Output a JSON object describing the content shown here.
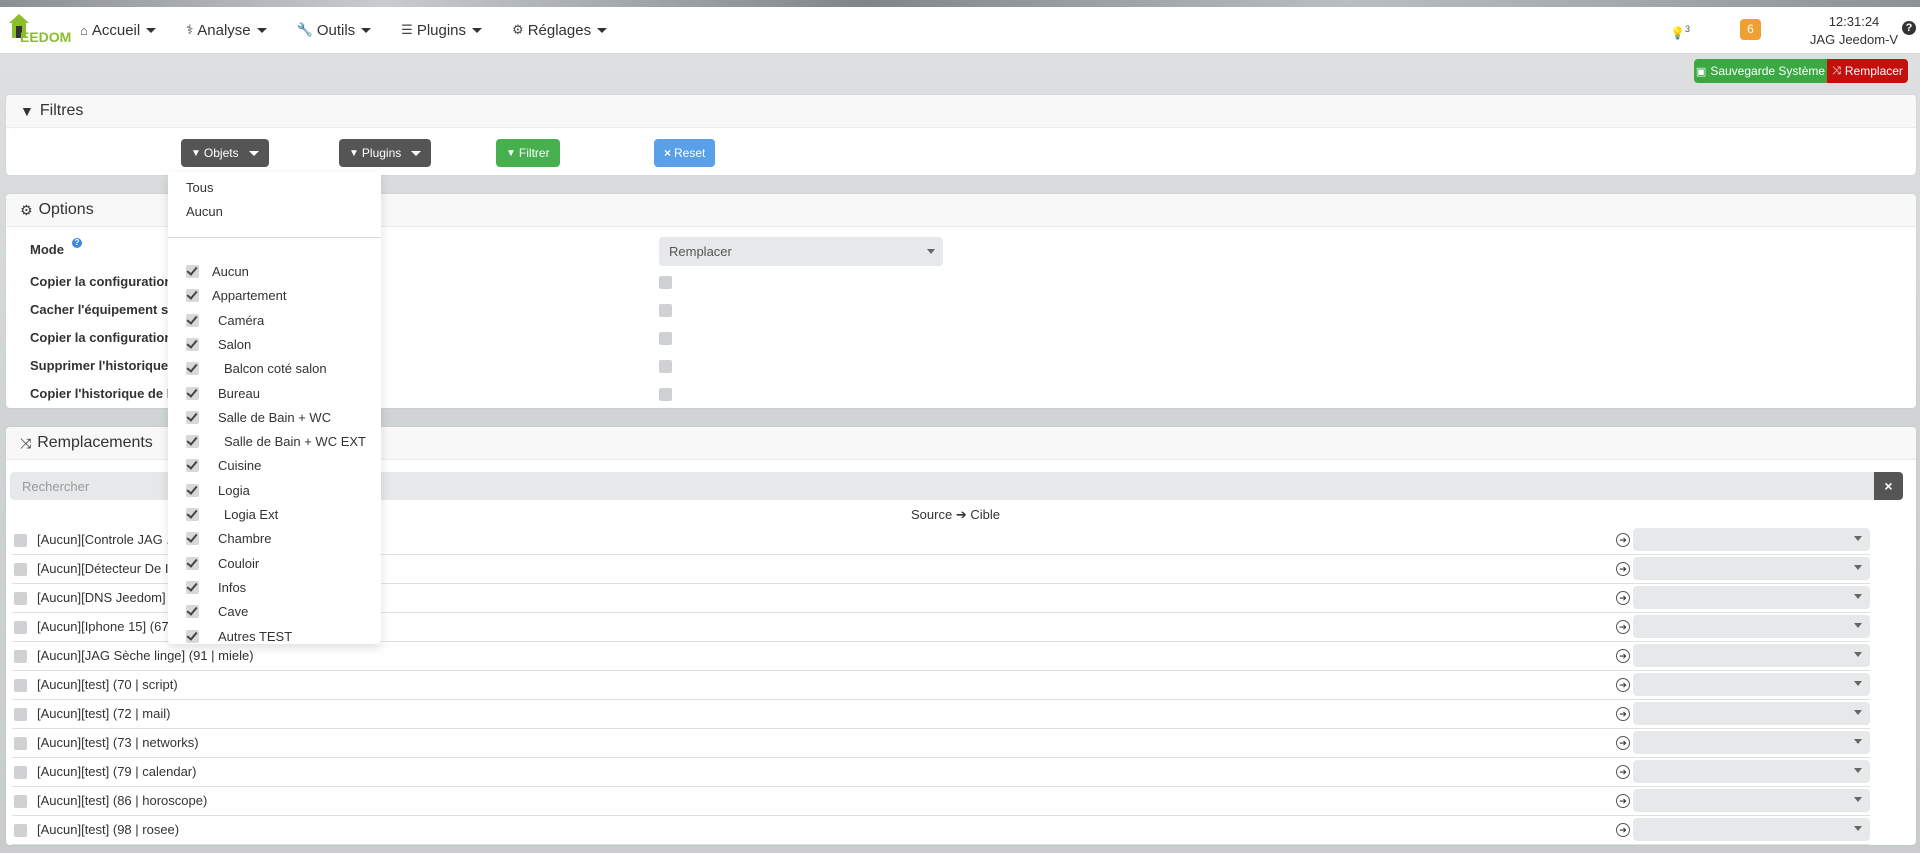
{
  "navbar": {
    "logo_text": "EEDOM",
    "items": [
      {
        "label": "Accueil",
        "icon": "home-icon"
      },
      {
        "label": "Analyse",
        "icon": "stethoscope-icon"
      },
      {
        "label": "Outils",
        "icon": "wrench-icon"
      },
      {
        "label": "Plugins",
        "icon": "list-icon"
      },
      {
        "label": "Réglages",
        "icon": "gear-icon"
      }
    ],
    "bulb_count": "3",
    "badge_count": "6",
    "time": "12:31:24",
    "user": "JAG Jeedom-V",
    "help": "?"
  },
  "actions": {
    "save_label": "Sauvegarde Système",
    "replace_label": "Remplacer"
  },
  "filters": {
    "title": "Filtres",
    "objets_label": "Objets",
    "plugins_label": "Plugins",
    "filtrer_label": "Filtrer",
    "reset_label": "Reset"
  },
  "options": {
    "title": "Options",
    "mode_label": "Mode",
    "mode_value": "Remplacer",
    "labels": [
      "Copier la configuration",
      "Cacher l'équipement s",
      "Copier la configuration",
      "Supprimer l'historique",
      "Copier l'historique de l"
    ]
  },
  "remplacements": {
    "title": "Remplacements",
    "search_placeholder": "Rechercher",
    "clear": "×",
    "source_cible_source": "Source",
    "source_cible_cible": "Cible",
    "rows": [
      "[Aucun][Controle JAG ...",
      "[Aucun][Détecteur De I",
      "[Aucun][DNS Jeedom]",
      "[Aucun][Iphone 15] (67",
      "[Aucun][JAG Sèche linge] (91 | miele)",
      "[Aucun][test] (70 | script)",
      "[Aucun][test] (72 | mail)",
      "[Aucun][test] (73 | networks)",
      "[Aucun][test] (79 | calendar)",
      "[Aucun][test] (86 | horoscope)",
      "[Aucun][test] (98 | rosee)"
    ]
  },
  "objets_dropdown": {
    "tous": "Tous",
    "aucun": "Aucun",
    "items": [
      {
        "label": "Aucun",
        "indent": 0
      },
      {
        "label": "Appartement",
        "indent": 0
      },
      {
        "label": "Caméra",
        "indent": 1
      },
      {
        "label": "Salon",
        "indent": 1
      },
      {
        "label": "Balcon coté salon",
        "indent": 2
      },
      {
        "label": "Bureau",
        "indent": 1
      },
      {
        "label": "Salle de Bain + WC",
        "indent": 1
      },
      {
        "label": "Salle de Bain + WC EXT",
        "indent": 2
      },
      {
        "label": "Cuisine",
        "indent": 1
      },
      {
        "label": "Logia",
        "indent": 1
      },
      {
        "label": "Logia Ext",
        "indent": 2
      },
      {
        "label": "Chambre",
        "indent": 1
      },
      {
        "label": "Couloir",
        "indent": 1
      },
      {
        "label": "Infos",
        "indent": 1
      },
      {
        "label": "Cave",
        "indent": 1
      },
      {
        "label": "Autres TEST",
        "indent": 1
      }
    ]
  },
  "colors": {
    "green": "#3aa843",
    "red": "#c4100c",
    "dark": "#555555",
    "filter_green": "#46b04e",
    "reset_blue": "#5aa0e8",
    "badge_orange": "#f0a030"
  }
}
